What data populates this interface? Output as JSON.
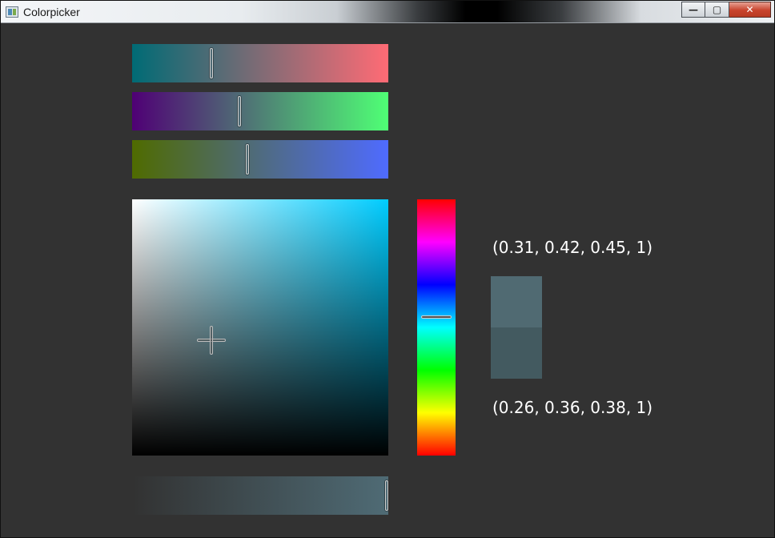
{
  "window": {
    "title": "Colorpicker",
    "buttons": {
      "minimize": "—",
      "maximize": "▢",
      "close": "✕"
    }
  },
  "sliders": {
    "red": {
      "value": 0.31,
      "from_color": "#006b75",
      "to_color": "#ff6b75"
    },
    "green": {
      "value": 0.42,
      "from_color": "#4f0075",
      "to_color": "#4fff75"
    },
    "blue": {
      "value": 0.45,
      "from_color": "#4f6b00",
      "to_color": "#4f6bff"
    },
    "alpha": {
      "value": 1.0,
      "color": "#4f6b75"
    }
  },
  "sv_picker": {
    "hue_color": "#00ccff",
    "saturation": 0.31,
    "value": 0.45
  },
  "hue_slider": {
    "hue_fraction": 0.46
  },
  "colors": {
    "new_color": {
      "label": "(0.31, 0.42, 0.45, 1)",
      "hex": "#506a72"
    },
    "old_color": {
      "label": "(0.26, 0.36, 0.38, 1)",
      "hex": "#435a60"
    }
  },
  "icons": {
    "app_icon": "colorpicker-app-icon",
    "crosshair": "crosshair-icon"
  }
}
